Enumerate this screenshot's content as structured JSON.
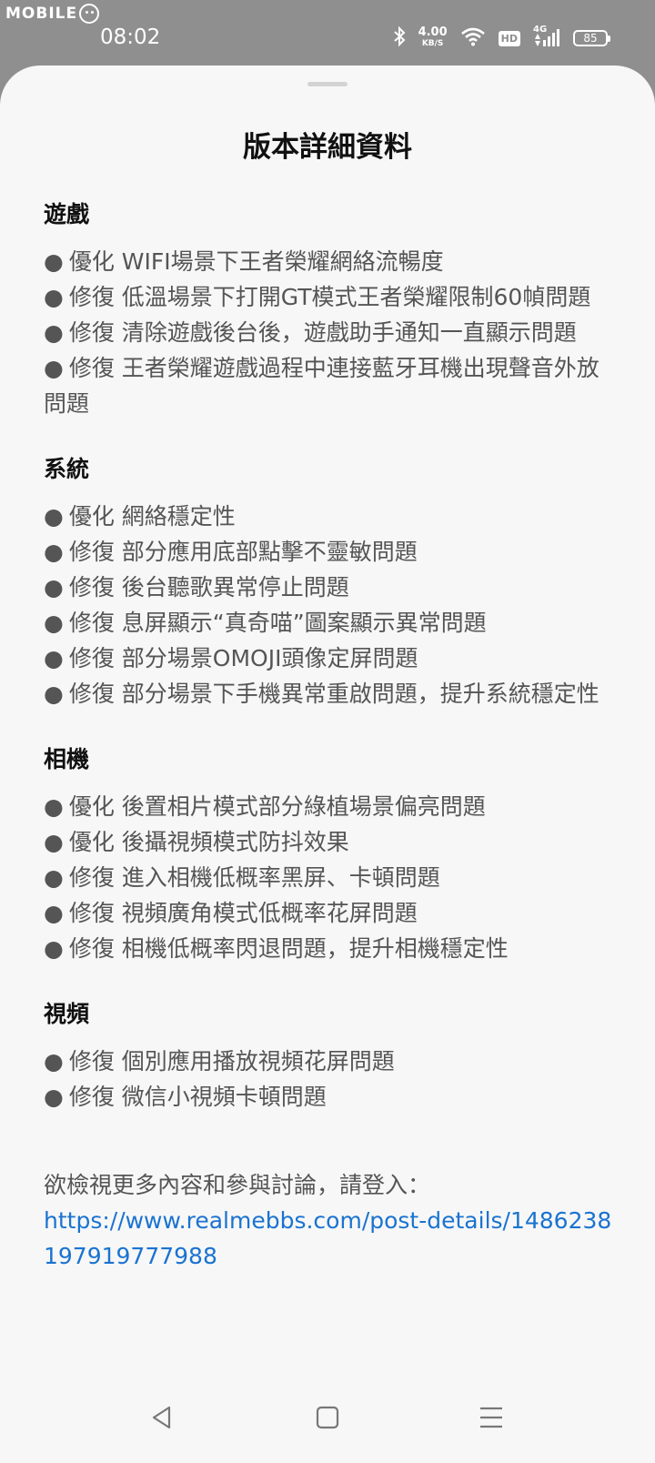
{
  "watermark": "MOBILE",
  "status_bar": {
    "time": "08:02",
    "net_speed_value": "4.00",
    "net_speed_unit": "KB/S",
    "hd_label": "HD",
    "signal_label": "4G",
    "battery_level": "85",
    "icons": [
      "bluetooth-icon",
      "wifi-icon",
      "hd-icon",
      "signal-icon",
      "battery-icon"
    ],
    "color": "#ffffff"
  },
  "sheet": {
    "title": "版本詳細資料",
    "sections": [
      {
        "heading": "遊戲",
        "items": [
          "優化 WIFI場景下王者榮耀網絡流暢度",
          "修復 低溫場景下打開GT模式王者榮耀限制60幀問題",
          "修復 清除遊戲後台後，遊戲助手通知一直顯示問題",
          "修復 王者榮耀遊戲過程中連接藍牙耳機出現聲音外放問題"
        ]
      },
      {
        "heading": "系統",
        "items": [
          "優化 網絡穩定性",
          "修復 部分應用底部點擊不靈敏問題",
          "修復 後台聽歌異常停止問題",
          "修復 息屏顯示“真奇喵”圖案顯示異常問題",
          "修復 部分場景OMOJI頭像定屏問題",
          "修復 部分場景下手機異常重啟問題，提升系統穩定性"
        ]
      },
      {
        "heading": "相機",
        "items": [
          "優化 後置相片模式部分綠植場景偏亮問題",
          "優化 後攝視頻模式防抖效果",
          "修復 進入相機低概率黑屏、卡頓問題",
          "修復 視頻廣角模式低概率花屏問題",
          "修復 相機低概率閃退問題，提升相機穩定性"
        ]
      },
      {
        "heading": "視頻",
        "items": [
          "修復 個別應用播放視頻花屏問題",
          "修復 微信小視頻卡頓問題"
        ]
      }
    ],
    "bullet": "●",
    "footer_text": "欲檢視更多內容和參與討論，請登入：",
    "footer_link": "https://www.realmebbs.com/post-details/1486238197919777988",
    "link_color": "#1a73d0",
    "background": "#f7f7f7"
  },
  "navbar": {
    "buttons": [
      "back-icon",
      "home-icon",
      "menu-icon"
    ]
  }
}
